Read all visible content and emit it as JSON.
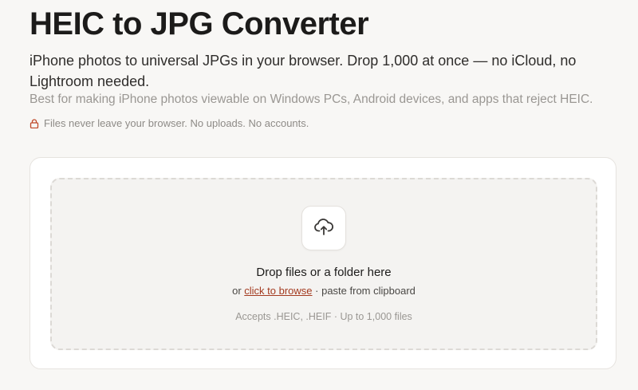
{
  "header": {
    "title": "HEIC to JPG Converter",
    "subtitle": "iPhone photos to universal JPGs in your browser. Drop 1,000 at once — no iCloud, no Lightroom needed.",
    "best_for": "Best for making iPhone photos viewable on Windows PCs, Android devices, and apps that reject HEIC.",
    "privacy_note": "Files never leave your browser. No uploads. No accounts.",
    "privacy_icon": "lock-icon"
  },
  "dropzone": {
    "upload_icon": "cloud-upload-icon",
    "title": "Drop files or a folder here",
    "sub_prefix": "or",
    "browse_link": "click to browse",
    "sub_suffix": "· paste from clipboard",
    "accepts": "Accepts .HEIC, .HEIF · Up to 1,000 files"
  },
  "colors": {
    "accent": "#a33a1f",
    "background": "#f8f7f5",
    "card": "#ffffff",
    "dropzone_bg": "#f4f3f1"
  }
}
